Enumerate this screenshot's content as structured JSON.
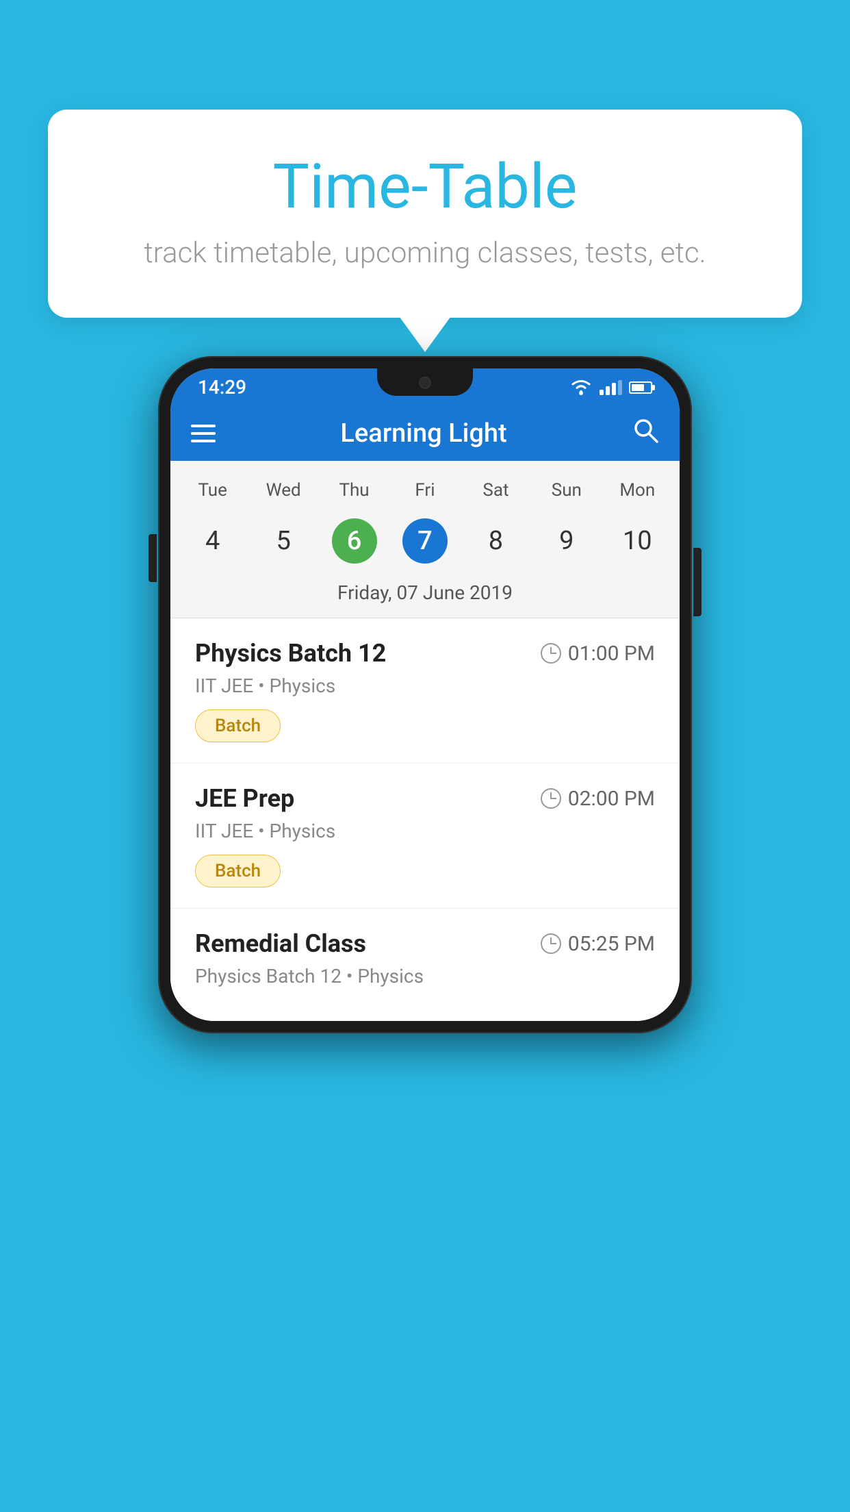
{
  "background_color": "#29b6e0",
  "bubble": {
    "title": "Time-Table",
    "subtitle": "track timetable, upcoming classes, tests, etc."
  },
  "phone": {
    "status_bar": {
      "time": "14:29"
    },
    "app_bar": {
      "title": "Learning Light"
    },
    "calendar": {
      "days": [
        {
          "label": "Tue",
          "number": "4"
        },
        {
          "label": "Wed",
          "number": "5"
        },
        {
          "label": "Thu",
          "number": "6",
          "state": "today"
        },
        {
          "label": "Fri",
          "number": "7",
          "state": "selected"
        },
        {
          "label": "Sat",
          "number": "8"
        },
        {
          "label": "Sun",
          "number": "9"
        },
        {
          "label": "Mon",
          "number": "10"
        }
      ],
      "selected_date_label": "Friday, 07 June 2019"
    },
    "schedule": [
      {
        "title": "Physics Batch 12",
        "time": "01:00 PM",
        "meta": "IIT JEE • Physics",
        "badge": "Batch"
      },
      {
        "title": "JEE Prep",
        "time": "02:00 PM",
        "meta": "IIT JEE • Physics",
        "badge": "Batch"
      },
      {
        "title": "Remedial Class",
        "time": "05:25 PM",
        "meta": "Physics Batch 12 • Physics",
        "badge": ""
      }
    ]
  }
}
